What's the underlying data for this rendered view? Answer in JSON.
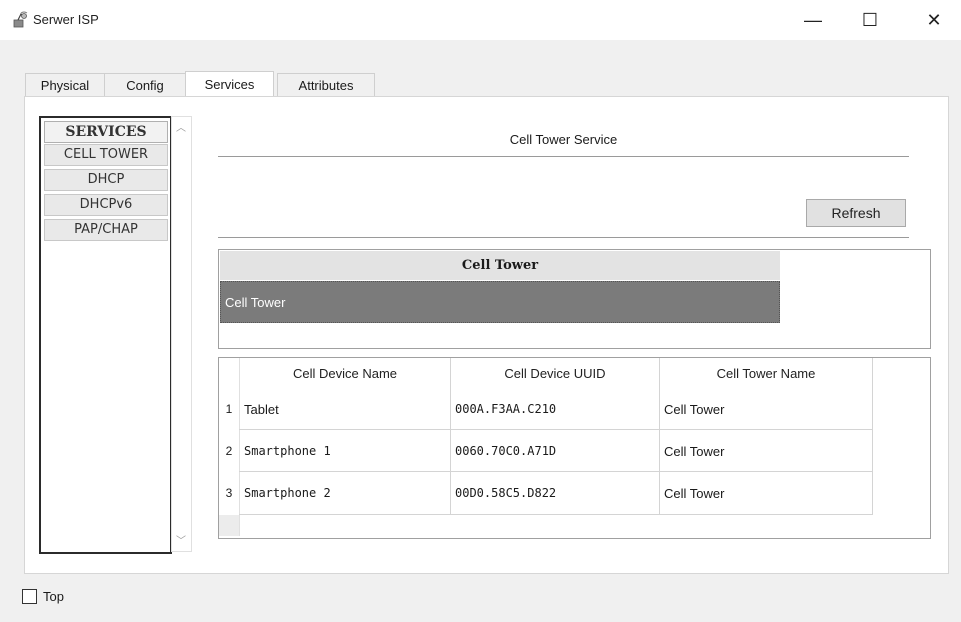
{
  "window": {
    "title": "Serwer ISP",
    "minimize": "—",
    "maximize": "☐",
    "close": "✕"
  },
  "tabs": [
    {
      "label": "Physical",
      "active": false
    },
    {
      "label": "Config",
      "active": false
    },
    {
      "label": "Services",
      "active": true
    },
    {
      "label": "Attributes",
      "active": false
    }
  ],
  "services": {
    "header": "SERVICES",
    "items": [
      "CELL TOWER",
      "DHCP",
      "DHCPv6",
      "PAP/CHAP"
    ]
  },
  "main": {
    "section_title": "Cell Tower Service",
    "refresh_label": "Refresh",
    "tower_table": {
      "header": "Cell Tower",
      "rows": [
        "Cell Tower"
      ]
    },
    "device_table": {
      "columns": [
        "Cell Device Name",
        "Cell Device UUID",
        "Cell Tower Name"
      ],
      "rows": [
        {
          "num": "1",
          "name": "Tablet",
          "uuid": "000A.F3AA.C210",
          "tower": "Cell Tower"
        },
        {
          "num": "2",
          "name": "Smartphone 1",
          "uuid": "0060.70C0.A71D",
          "tower": "Cell Tower"
        },
        {
          "num": "3",
          "name": "Smartphone 2",
          "uuid": "00D0.58C5.D822",
          "tower": "Cell Tower"
        }
      ]
    }
  },
  "footer": {
    "top_label": "Top",
    "top_checked": false
  }
}
